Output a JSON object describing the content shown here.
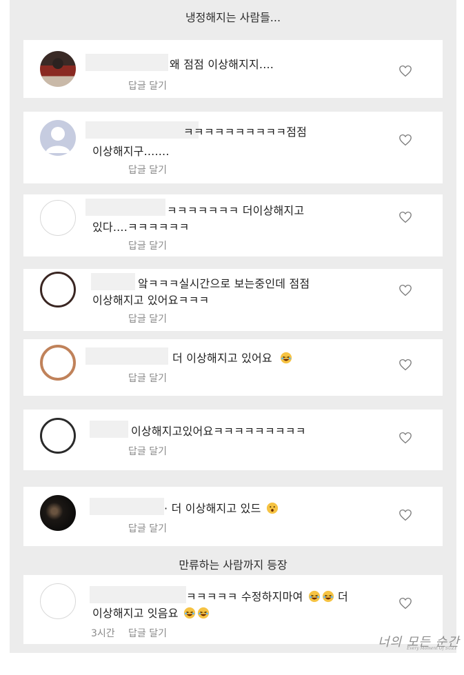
{
  "header_caption": "냉정해지는 사람들...",
  "mid_caption": "만류하는 사람까지 등장",
  "reply_label": "답글 달기",
  "comments": [
    {
      "line1": "왜 점점 이상해지지....",
      "line2": ""
    },
    {
      "line1": "ㅋㅋㅋㅋㅋㅋㅋㅋㅋㅋ점점",
      "line2": "이상해지구......."
    },
    {
      "line1": "ㅋㅋㅋㅋㅋㅋㅋ 더이상해지고",
      "line2": "있다....ㅋㅋㅋㅋㅋㅋ"
    },
    {
      "line1": "앜ㅋㅋㅋ실시간으로 보는중인데 점점",
      "line2": "이상해지고 있어요ㅋㅋㅋ"
    },
    {
      "line1": "더 이상해지고 있어요",
      "line2": ""
    },
    {
      "line1": "이상해지고있어요ㅋㅋㅋㅋㅋㅋㅋㅋㅋ",
      "line2": ""
    },
    {
      "line1": "· 더 이상해지고 있드",
      "line2": ""
    },
    {
      "line1": "ㅋㅋㅋㅋㅋ 수정하지마여",
      "line1_tail": "더",
      "line2": "이상해지고 잇음요",
      "time": "3시간"
    }
  ],
  "icons": {
    "like": "heart-outline-icon"
  },
  "watermark": {
    "main": "너의 모든 순간",
    "sub": "Every Moment Of SUZY"
  },
  "colors": {
    "panel_bg": "#ececec",
    "card_bg": "#ffffff",
    "meta_text": "#8a8a8a"
  }
}
